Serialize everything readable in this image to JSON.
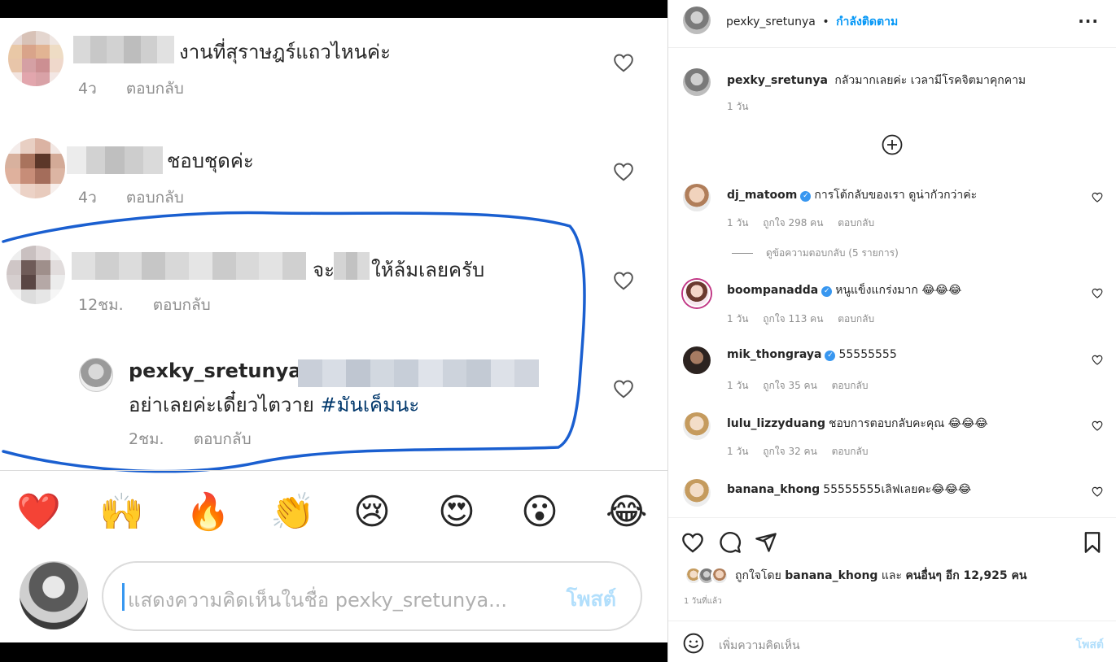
{
  "left_panel": {
    "comments": [
      {
        "text": "งานที่สุราษฎร์แถวไหนค่ะ",
        "time": "4ว",
        "reply": "ตอบกลับ"
      },
      {
        "text": "ชอบชุดค่ะ",
        "time": "4ว",
        "reply": "ตอบกลับ"
      },
      {
        "text_prefix": "จะ",
        "text_suffix": "ให้ล้มเลยครับ",
        "time": "12ชม.",
        "reply": "ตอบกลับ"
      }
    ],
    "reply": {
      "username": "pexky_sretunya",
      "text": "อย่าเลยค่ะเดี๋ยวไตวาย",
      "hashtag": "#มันเค็มนะ",
      "time": "2ชม.",
      "reply": "ตอบกลับ"
    },
    "emojis": [
      "❤️",
      "🙌",
      "🔥",
      "👏",
      "😢",
      "😍",
      "😮",
      "😂"
    ],
    "comment_box": {
      "placeholder": "แสดงความคิดเห็นในชื่อ pexky_sretunya...",
      "post_label": "โพสต์"
    }
  },
  "right_panel": {
    "header": {
      "username": "pexky_sretunya",
      "separator": "•",
      "follow_status": "กำลังติดตาม",
      "more": "···"
    },
    "caption": {
      "username": "pexky_sretunya",
      "text": "กลัวมากเลยค่ะ เวลามีโรคจิตมาคุกคาม",
      "time": "1 วัน"
    },
    "comments": [
      {
        "username": "dj_matoom",
        "verified": true,
        "text": "การโต้กลับของเรา ดูน่ากัวกว่าค่ะ",
        "time": "1 วัน",
        "likes": "ถูกใจ 298 คน",
        "reply": "ตอบกลับ"
      },
      {
        "username": "boompanadda",
        "verified": true,
        "text": "หนูแข็งแกร่งมาก 😂😂😂",
        "time": "1 วัน",
        "likes": "ถูกใจ 113 คน",
        "reply": "ตอบกลับ"
      },
      {
        "username": "mik_thongraya",
        "verified": true,
        "text": "55555555",
        "time": "1 วัน",
        "likes": "ถูกใจ 35 คน",
        "reply": "ตอบกลับ"
      },
      {
        "username": "lulu_lizzyduang",
        "verified": false,
        "text": "ชอบการตอบกลับคะคุณ 😂😂😂",
        "time": "1 วัน",
        "likes": "ถูกใจ 32 คน",
        "reply": "ตอบกลับ"
      },
      {
        "username": "banana_khong",
        "verified": false,
        "text": "55555555เลิฟเลยคะ😂😂😂",
        "time": "",
        "likes": "",
        "reply": ""
      }
    ],
    "view_replies": "ดูข้อความตอบกลับ (5 รายการ)",
    "likes": {
      "prefix": "ถูกใจโดย",
      "user": "banana_khong",
      "and": "และ",
      "others": "คนอื่นๆ อีก 12,925 คน"
    },
    "time_ago": "1 วันที่แล้ว",
    "add_comment": {
      "placeholder": "เพิ่มความคิดเห็น",
      "post_label": "โพสต์"
    }
  }
}
